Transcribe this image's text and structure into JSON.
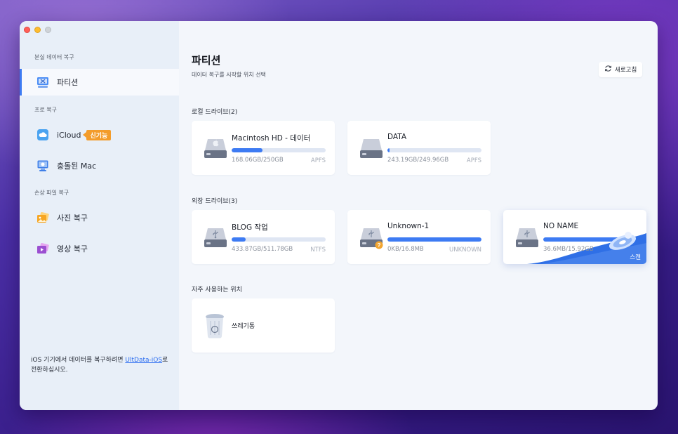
{
  "sidebar": {
    "sections": [
      {
        "title": "분실 데이터 복구"
      },
      {
        "title": "프로 복구"
      },
      {
        "title": "손상 파일 복구"
      }
    ],
    "items": [
      {
        "label": "파티션",
        "icon": "partition-icon"
      },
      {
        "label": "iCloud",
        "icon": "icloud-icon",
        "badge": "신기능"
      },
      {
        "label": "충돌된 Mac",
        "icon": "crashed-mac-icon"
      },
      {
        "label": "사진 복구",
        "icon": "photo-icon"
      },
      {
        "label": "영상 복구",
        "icon": "video-icon"
      }
    ],
    "footer": {
      "prefix": "iOS 기기에서 데이터를 복구하려면 ",
      "link": "UltData-iOS",
      "suffix": "로 전환하십시오."
    }
  },
  "main": {
    "title": "파티션",
    "subtitle": "데이터 복구를 시작할 위치 선택",
    "refresh_label": "새로고침",
    "groups": {
      "local": {
        "title": "로컬 드라이브(2)"
      },
      "external": {
        "title": "외장 드라이브(3)"
      },
      "frequent": {
        "title": "자주 사용하는 위치"
      }
    },
    "drives": {
      "macintosh": {
        "name": "Macintosh HD - 데이터",
        "size": "168.06GB/250GB",
        "fs": "APFS",
        "usage": 0.33
      },
      "data": {
        "name": "DATA",
        "size": "243.19GB/249.96GB",
        "fs": "APFS",
        "usage": 0.02
      },
      "blog": {
        "name": "BLOG 작업",
        "size": "433.87GB/511.78GB",
        "fs": "NTFS",
        "usage": 0.15
      },
      "unknown": {
        "name": "Unknown-1",
        "size": "0KB/16.8MB",
        "fs": "UNKNOWN",
        "usage": 1.0
      },
      "noname": {
        "name": "NO NAME",
        "size": "36.6MB/15.92GB",
        "scan_label": "스캔",
        "usage": 0.98
      }
    },
    "trash": {
      "name": "쓰레기통"
    }
  },
  "colors": {
    "accent": "#3d7bf3",
    "badge": "#f39c2b"
  }
}
